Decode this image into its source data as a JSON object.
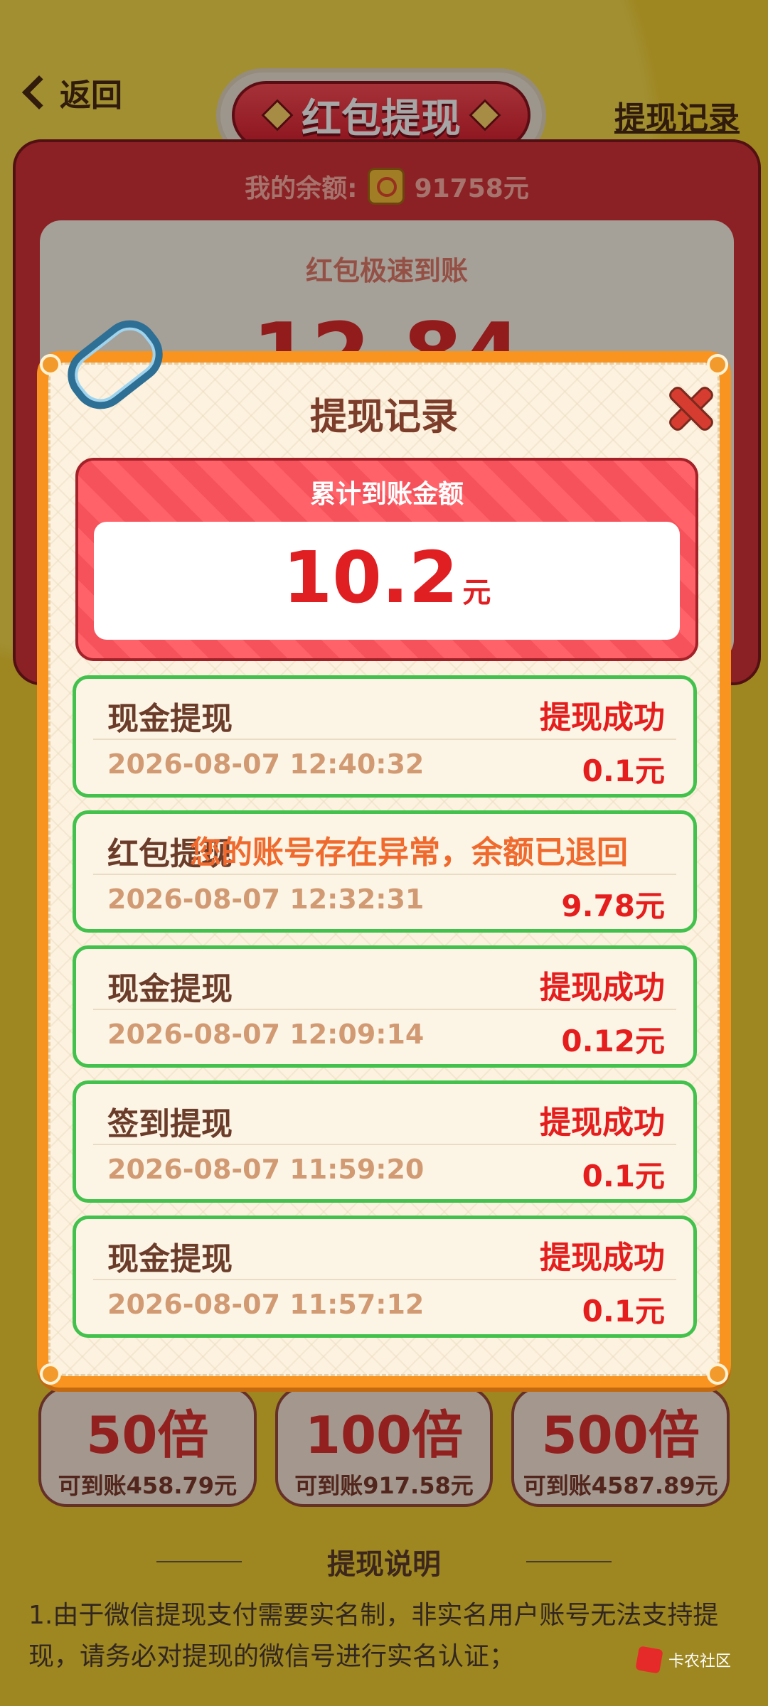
{
  "header": {
    "back_label": "返回",
    "title": "红包提现",
    "record_link": "提现记录"
  },
  "balance": {
    "label": "我的余额:",
    "value": "91758元"
  },
  "main": {
    "speed_label": "红包极速到账",
    "amount_partial": "12.84"
  },
  "modal": {
    "title": "提现记录",
    "total_label": "累计到账金额",
    "total_value": "10.2",
    "total_unit": "元",
    "records": [
      {
        "type": "现金提现",
        "status": "提现成功",
        "time": "2026-08-07 12:40:32",
        "amount": "0.1元"
      },
      {
        "type": "红包提现",
        "status": "您的账号存在异常，余额已退回",
        "time": "2026-08-07 12:32:31",
        "amount": "9.78元"
      },
      {
        "type": "现金提现",
        "status": "提现成功",
        "time": "2026-08-07 12:09:14",
        "amount": "0.12元"
      },
      {
        "type": "签到提现",
        "status": "提现成功",
        "time": "2026-08-07 11:59:20",
        "amount": "0.1元"
      },
      {
        "type": "现金提现",
        "status": "提现成功",
        "time": "2026-08-07 11:57:12",
        "amount": "0.1元"
      }
    ]
  },
  "multipliers": [
    {
      "label": "50倍",
      "sub": "可到账458.79元"
    },
    {
      "label": "100倍",
      "sub": "可到账917.58元"
    },
    {
      "label": "500倍",
      "sub": "可到账4587.89元"
    }
  ],
  "explain": {
    "title": "提现说明",
    "text": "1.由于微信提现支付需要实名制，非实名用户账号无法支持提现，请务必对提现的微信号进行实名认证；"
  },
  "watermark": {
    "text": "卡农社区"
  }
}
